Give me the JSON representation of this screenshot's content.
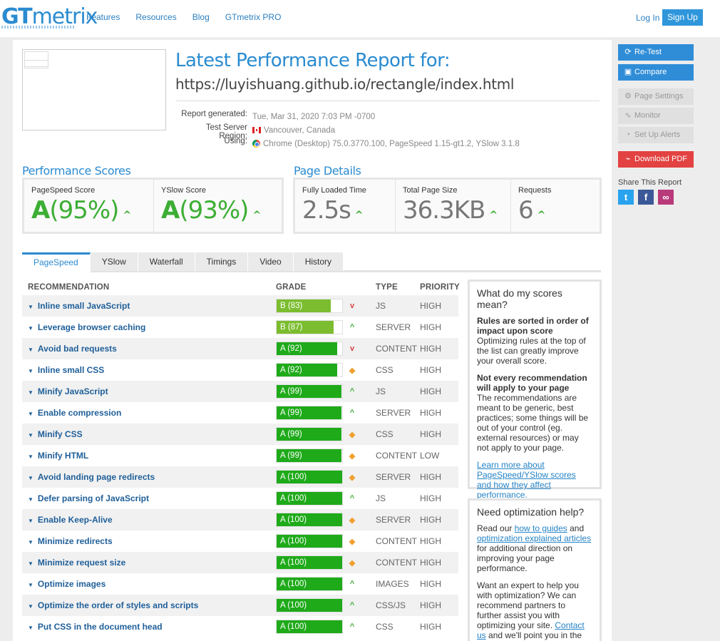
{
  "nav": {
    "logo_gt": "GT",
    "logo_rest": "metrix",
    "links": [
      "Features",
      "Resources",
      "Blog",
      "GTmetrix PRO"
    ],
    "login": "Log In",
    "signup": "Sign Up"
  },
  "report": {
    "title": "Latest Performance Report for:",
    "url": "https://luyishuang.github.io/rectangle/index.html",
    "meta": [
      {
        "label": "Report generated:",
        "value": "Tue, Mar 31, 2020 7:03 PM -0700",
        "icon": ""
      },
      {
        "label": "Test Server Region:",
        "value": "Vancouver, Canada",
        "icon": "canada-flag-icon"
      },
      {
        "label": "Using:",
        "value": "Chrome (Desktop) 75.0.3770.100, PageSpeed 1.15-gt1.2, YSlow 3.1.8",
        "icon": "chrome-icon"
      }
    ]
  },
  "scores": {
    "title": "Performance Scores",
    "pagespeed": {
      "label": "PageSpeed Score",
      "grade": "A",
      "pct": "(95%)"
    },
    "yslow": {
      "label": "YSlow Score",
      "grade": "A",
      "pct": "(93%)"
    }
  },
  "details": {
    "title": "Page Details",
    "loaded": {
      "label": "Fully Loaded Time",
      "value": "2.5s"
    },
    "size": {
      "label": "Total Page Size",
      "value": "36.3KB"
    },
    "requests": {
      "label": "Requests",
      "value": "6"
    }
  },
  "tabs": [
    "PageSpeed",
    "YSlow",
    "Waterfall",
    "Timings",
    "Video",
    "History"
  ],
  "table": {
    "headers": {
      "rec": "RECOMMENDATION",
      "grade": "GRADE",
      "type": "TYPE",
      "priority": "PRIORITY"
    },
    "rows": [
      {
        "rec": "Inline small JavaScript",
        "grade": "B (83)",
        "score": 83,
        "trend": "down",
        "type": "JS",
        "priority": "HIGH"
      },
      {
        "rec": "Leverage browser caching",
        "grade": "B (87)",
        "score": 87,
        "trend": "up",
        "type": "SERVER",
        "priority": "HIGH"
      },
      {
        "rec": "Avoid bad requests",
        "grade": "A (92)",
        "score": 92,
        "trend": "down",
        "type": "CONTENT",
        "priority": "HIGH"
      },
      {
        "rec": "Inline small CSS",
        "grade": "A (92)",
        "score": 92,
        "trend": "flat",
        "type": "CSS",
        "priority": "HIGH"
      },
      {
        "rec": "Minify JavaScript",
        "grade": "A (99)",
        "score": 99,
        "trend": "up",
        "type": "JS",
        "priority": "HIGH"
      },
      {
        "rec": "Enable compression",
        "grade": "A (99)",
        "score": 99,
        "trend": "up",
        "type": "SERVER",
        "priority": "HIGH"
      },
      {
        "rec": "Minify CSS",
        "grade": "A (99)",
        "score": 99,
        "trend": "flat",
        "type": "CSS",
        "priority": "HIGH"
      },
      {
        "rec": "Minify HTML",
        "grade": "A (99)",
        "score": 99,
        "trend": "flat",
        "type": "CONTENT",
        "priority": "LOW"
      },
      {
        "rec": "Avoid landing page redirects",
        "grade": "A (100)",
        "score": 100,
        "trend": "flat",
        "type": "SERVER",
        "priority": "HIGH"
      },
      {
        "rec": "Defer parsing of JavaScript",
        "grade": "A (100)",
        "score": 100,
        "trend": "up",
        "type": "JS",
        "priority": "HIGH"
      },
      {
        "rec": "Enable Keep-Alive",
        "grade": "A (100)",
        "score": 100,
        "trend": "flat",
        "type": "SERVER",
        "priority": "HIGH"
      },
      {
        "rec": "Minimize redirects",
        "grade": "A (100)",
        "score": 100,
        "trend": "flat",
        "type": "CONTENT",
        "priority": "HIGH"
      },
      {
        "rec": "Minimize request size",
        "grade": "A (100)",
        "score": 100,
        "trend": "flat",
        "type": "CONTENT",
        "priority": "HIGH"
      },
      {
        "rec": "Optimize images",
        "grade": "A (100)",
        "score": 100,
        "trend": "up",
        "type": "IMAGES",
        "priority": "HIGH"
      },
      {
        "rec": "Optimize the order of styles and scripts",
        "grade": "A (100)",
        "score": 100,
        "trend": "up",
        "type": "CSS/JS",
        "priority": "HIGH"
      },
      {
        "rec": "Put CSS in the document head",
        "grade": "A (100)",
        "score": 100,
        "trend": "up",
        "type": "CSS",
        "priority": "HIGH"
      }
    ]
  },
  "info1": {
    "title": "What do my scores mean?",
    "p1_bold": "Rules are sorted in order of impact upon score",
    "p1": "Optimizing rules at the top of the list can greatly improve your overall score.",
    "p2_bold": "Not every recommendation will apply to your page",
    "p2": "The recommendations are meant to be generic, best practices; some things will be out of your control (eg. external resources) or may not apply to your page.",
    "link": "Learn more about PageSpeed/YSlow scores and how they affect performance."
  },
  "info2": {
    "title": "Need optimization help?",
    "p1_a": "Read our ",
    "p1_link1": "how to guides",
    "p1_b": " and ",
    "p1_link2": "optimization explained articles",
    "p1_c": " for additional direction on improving your page performance.",
    "p2_a": "Want an expert to help you with optimization? We can recommend partners to further assist you with optimizing your site. ",
    "p2_link": "Contact us",
    "p2_b": " and we'll point you in the right direction."
  },
  "sidebar": {
    "retest": "Re-Test",
    "compare": "Compare",
    "page_settings": "Page Settings",
    "monitor": "Monitor",
    "alerts": "Set Up Alerts",
    "download": "Download PDF",
    "share": "Share This Report"
  },
  "colors": {
    "brand": "#2a8bd0",
    "grade_a": "#1faa1a",
    "grade_b": "#7bbd2f",
    "trend_up": "#3cae34",
    "trend_down": "#d94545",
    "trend_flat": "#f0a030"
  }
}
